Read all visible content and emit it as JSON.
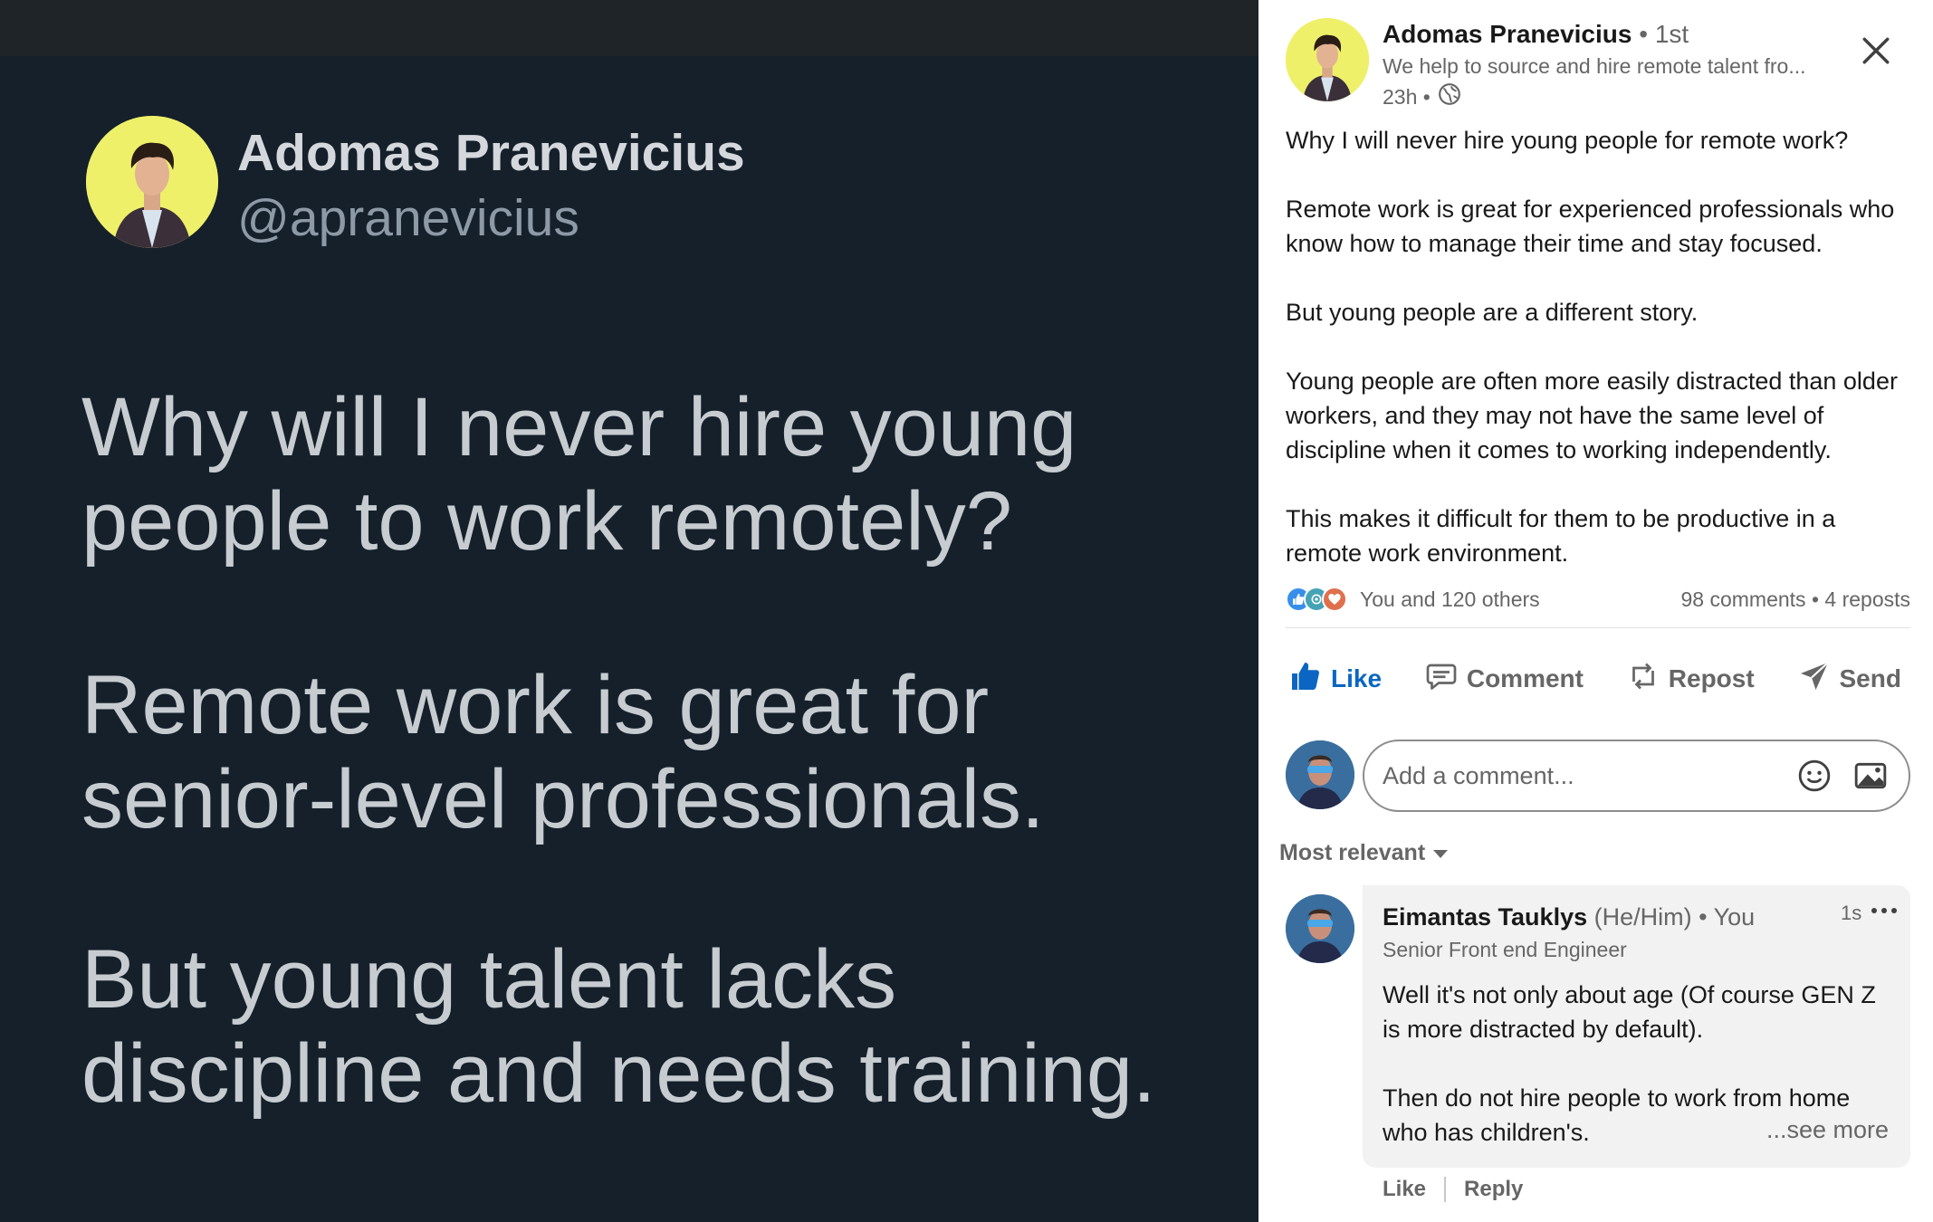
{
  "image_post": {
    "name": "Adomas Pranevicius",
    "handle": "@apranevicius",
    "paragraphs": [
      "Why will I never hire young people to work remotely?",
      "Remote work is great for senior-level professionals.",
      "But young talent lacks discipline and needs training."
    ]
  },
  "post": {
    "author_name": "Adomas Pranevicius",
    "degree": " • 1st",
    "headline": "We help to source and hire remote talent fro...",
    "time": "23h •",
    "body": [
      "Why I will never hire young people for remote work?",
      "Remote work is great for experienced professionals who know how to manage their time and stay focused.",
      "But young people are a different story.",
      "Young people are often more easily distracted than older workers, and they may not have the same level of discipline when it comes to working independently.",
      "This makes it difficult for them to be productive in a remote work environment."
    ],
    "reactions_text": "You and 120 others",
    "comments_reposts": "98 comments • 4 reposts"
  },
  "actions": {
    "like": "Like",
    "comment": "Comment",
    "repost": "Repost",
    "send": "Send"
  },
  "comment_box": {
    "placeholder": "Add a comment..."
  },
  "sort": {
    "label": "Most relevant"
  },
  "comment": {
    "author": "Eimantas Tauklys",
    "pronouns": " (He/Him)",
    "you": " • You",
    "time": "1s",
    "headline": "Senior Front end Engineer",
    "text": [
      "Well it's not only about age (Of course GEN Z is more distracted by default).",
      "Then do not hire people to work from home who has children's."
    ],
    "see_more": "...see more",
    "like": "Like",
    "reply": "Reply"
  },
  "colors": {
    "image_bg": "#15202b",
    "avatar_yellow": "#eef06a",
    "linkedin_blue": "#0a66c2",
    "muted_text": "#666666"
  },
  "icons": [
    "close-icon",
    "globe-icon",
    "like-thumb-icon",
    "comment-bubble-icon",
    "repost-icon",
    "send-icon",
    "emoji-icon",
    "image-icon",
    "caret-down-icon",
    "more-dots-icon"
  ]
}
